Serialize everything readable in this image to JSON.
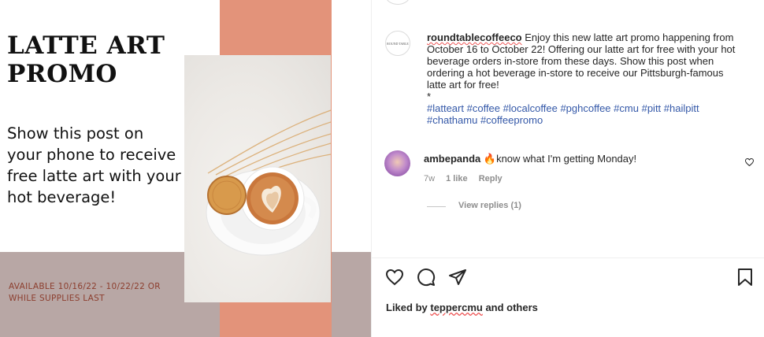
{
  "promo_image": {
    "title": "LATTE ART PROMO",
    "body": "Show this post on your phone to receive free latte art with your hot beverage!",
    "availability": "AVAILABLE 10/16/22 - 10/22/22 OR WHILE SUPPLIES LAST"
  },
  "caption": {
    "username": "roundtablecoffeeco",
    "text": " Enjoy this new latte art promo happening from October 16 to October 22! Offering our latte art for free with your hot beverage orders in-store from these days. Show this post when ordering a hot beverage in-store to receive our Pittsburgh-famous latte art for free!",
    "separator": "*",
    "hashtags": [
      "#latteart",
      "#coffee",
      "#localcoffee",
      "#pghcoffee",
      "#cmu",
      "#pitt",
      "#hailpitt",
      "#chathamu",
      "#coffeepromo"
    ]
  },
  "comment": {
    "username": "ambepanda",
    "emoji": "🔥",
    "text": "know what I'm getting Monday!",
    "age": "7w",
    "likes": "1 like",
    "reply": "Reply",
    "view_replies": "View replies (1)"
  },
  "likes": {
    "prefix": "Liked by ",
    "user": "teppercmu",
    "suffix": " and others"
  },
  "icons": [
    "heart-icon",
    "comment-icon",
    "share-icon",
    "bookmark-icon",
    "comment-like-icon"
  ],
  "colors": {
    "accent_orange": "#e3937a",
    "band_mauve": "#b8a7a5",
    "availability_text": "#8c3e2e",
    "hashtag_blue": "#3458a8",
    "muted_text": "#8e8e8e"
  }
}
